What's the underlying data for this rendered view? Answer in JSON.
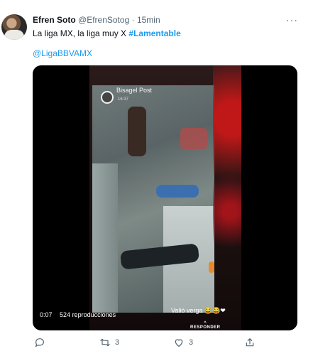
{
  "tweet": {
    "author_name": "Efren Soto",
    "handle": "@EfrenSotog",
    "separator": "·",
    "time": "15min",
    "more": "···",
    "text": "La liga MX, la liga muy X ",
    "hashtag": "#Lamentable",
    "mention": "@LigaBBVAMX"
  },
  "media": {
    "ig_name": "Bisagel Post",
    "ig_time": "16:37",
    "caption": "Valió verga 😂😂❤",
    "reply_label": "RESPONDER",
    "duration": "0:07",
    "views": "524 reproducciones"
  },
  "actions": {
    "reply_count": "",
    "retweet_count": "3",
    "like_count": "3"
  },
  "icons": {
    "reply": "reply-icon",
    "retweet": "retweet-icon",
    "like": "heart-icon",
    "share": "share-icon"
  },
  "colors": {
    "accent": "#1d9bf0",
    "muted": "#536471"
  }
}
